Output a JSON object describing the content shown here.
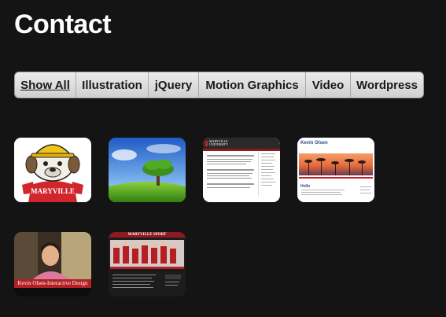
{
  "page": {
    "title": "Contact"
  },
  "filters": [
    {
      "label": "Show All",
      "active": true
    },
    {
      "label": "Illustration",
      "active": false
    },
    {
      "label": "jQuery",
      "active": false
    },
    {
      "label": "Motion Graphics",
      "active": false
    },
    {
      "label": "Video",
      "active": false
    },
    {
      "label": "Wordpress",
      "active": false
    }
  ],
  "thumbnails": {
    "mascot": {
      "name": "MARYVILLE",
      "icon": "mascot-illustration-icon"
    },
    "tree": {
      "icon": "tree-landscape-icon"
    },
    "maryville_site": {
      "name": "MARYVILLE UNIVERSITY"
    },
    "kevin_site": {
      "name": "Kevin Olsen",
      "section": "Hello"
    },
    "video": {
      "caption": "Kevin Olsen-Interactive Design"
    },
    "maryville_sport": {
      "name": "MARYVILLE SPORT"
    }
  },
  "colors": {
    "background": "#141414",
    "accent_red": "#c8202a"
  }
}
